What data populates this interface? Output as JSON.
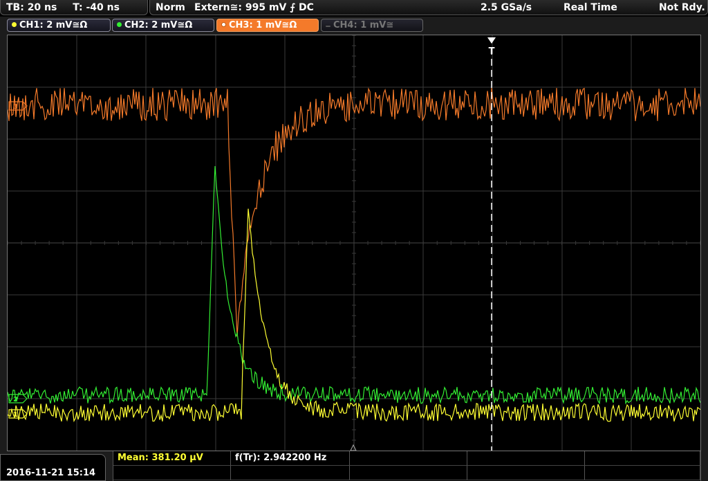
{
  "status": {
    "timebase": "TB: 20 ns",
    "trigger_time": "T: -40 ns",
    "trigger_mode": "Norm",
    "trigger_source": "Extern≅: 995 mV ⨍ DC",
    "sample_rate": "2.5 GSa/s",
    "acq_mode": "Real Time",
    "run_state": "Not Rdy."
  },
  "channels": [
    {
      "label": "CH1: 2 mV≅Ω",
      "color": "#ffff33"
    },
    {
      "label": "CH2: 2 mV≅Ω",
      "color": "#33ee33"
    },
    {
      "label": "CH3: 1 mV≅Ω",
      "color": "#f47a2a"
    },
    {
      "label": "CH4: 1 mV≅",
      "color": "#777777"
    }
  ],
  "markers": {
    "trigger": "T",
    "ch1_tag": "1",
    "ch2_tag": "2",
    "ch3_tag": "3"
  },
  "datetime": "2016-11-21 15:14",
  "measurements": {
    "mean": "Mean: 381.20 µV",
    "freq": "f(Tr): 2.942200 Hz"
  },
  "colors": {
    "ch1": "#ffff33",
    "ch2": "#33ee33",
    "ch3": "#f47a2a",
    "grid": "#3a3a3a"
  }
}
